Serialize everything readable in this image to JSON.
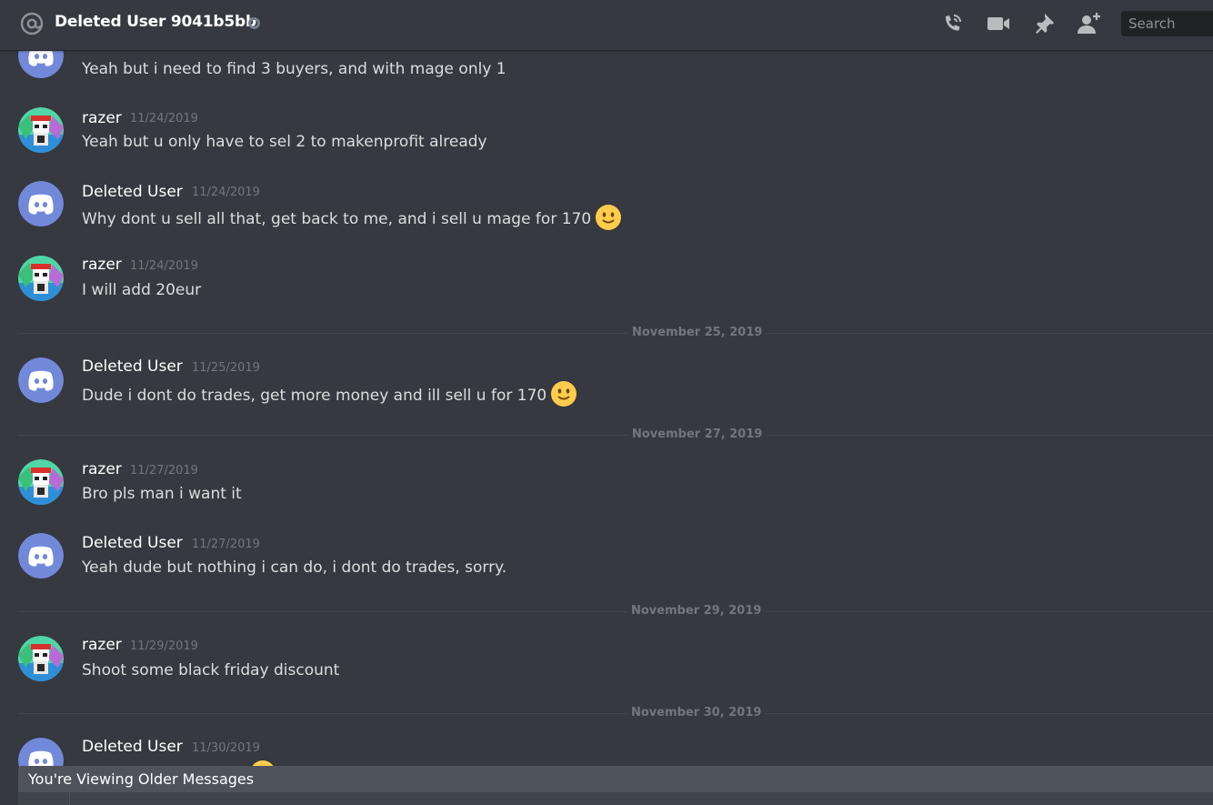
{
  "header": {
    "title": "Deleted User 9041b5bb",
    "search_placeholder": "Search",
    "icons": [
      "at-icon",
      "status-offline-icon",
      "voice-call-icon",
      "video-call-icon",
      "pin-icon",
      "add-friend-icon"
    ]
  },
  "messages": [
    {
      "author": "",
      "timestamp": "",
      "text": "Yeah but i need to find 3 buyers, and with mage only 1",
      "avatar": "discord-default"
    },
    {
      "author": "razer",
      "timestamp": "11/24/2019",
      "text": "Yeah but u only have to sel 2 to makenprofit already",
      "avatar": "razer"
    },
    {
      "author": "Deleted User",
      "timestamp": "11/24/2019",
      "text": "Why dont u sell all that, get back to me, and i sell u mage for 170",
      "emoji": "slight-smile",
      "avatar": "discord-default"
    },
    {
      "author": "razer",
      "timestamp": "11/24/2019",
      "text": "I will add 20eur",
      "avatar": "razer"
    },
    {
      "author": "Deleted User",
      "timestamp": "11/25/2019",
      "text": "Dude i dont do trades, get more money and ill sell u for 170",
      "emoji": "slight-smile",
      "avatar": "discord-default"
    },
    {
      "author": "razer",
      "timestamp": "11/27/2019",
      "text": "Bro pls man i want it",
      "avatar": "razer"
    },
    {
      "author": "Deleted User",
      "timestamp": "11/27/2019",
      "text": "Yeah dude but nothing i can do, i dont do trades, sorry.",
      "avatar": "discord-default"
    },
    {
      "author": "razer",
      "timestamp": "11/29/2019",
      "text": "Shoot some black friday discount",
      "avatar": "razer"
    },
    {
      "author": "Deleted User",
      "timestamp": "11/30/2019",
      "text": "",
      "avatar": "discord-default"
    }
  ],
  "dividers": [
    "November 25, 2019",
    "November 27, 2019",
    "November 29, 2019",
    "November 30, 2019"
  ],
  "older_messages_bar": "You're Viewing Older Messages",
  "colors": {
    "background": "#36393f",
    "blurple": "#7289da",
    "emoji_yellow": "#ffcc4d"
  }
}
